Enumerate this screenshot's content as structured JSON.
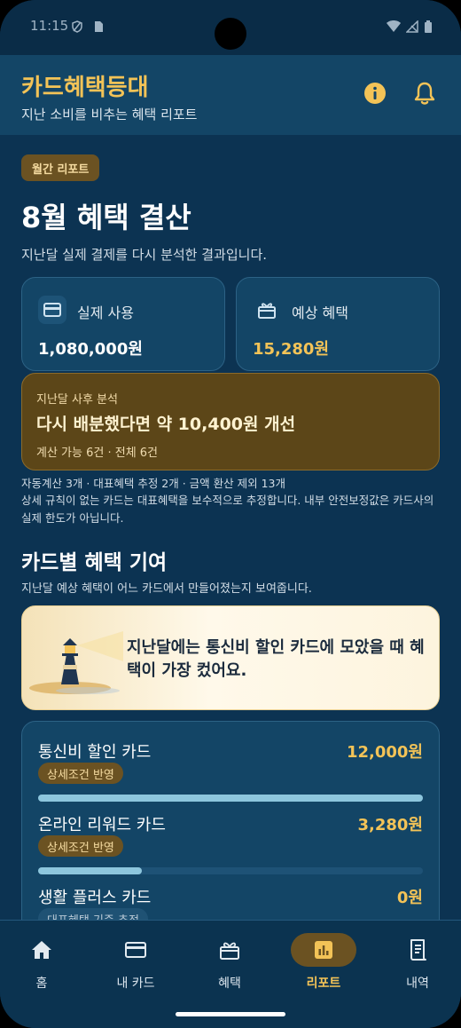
{
  "status_bar": {
    "time": "11:15"
  },
  "header": {
    "title": "카드혜택등대",
    "subtitle": "지난 소비를 비추는 혜택 리포트"
  },
  "report": {
    "badge": "월간 리포트",
    "title": "8월 혜택 결산",
    "description": "지난달 실제 결제를 다시 분석한 결과입니다."
  },
  "stats": [
    {
      "label": "실제 사용",
      "value": "1,080,000원",
      "icon": "credit-card-icon"
    },
    {
      "label": "예상 혜택",
      "value": "15,280원",
      "icon": "gift-icon"
    }
  ],
  "analysis": {
    "label": "지난달 사후 분석",
    "headline": "다시 배분했다면 약 10,400원 개선",
    "meta": "계산 가능 6건 · 전체 6건"
  },
  "notes": {
    "line1": "자동계산 3개 · 대표혜택 추정 2개 · 금액 환산 제외 13개",
    "line2": "상세 규칙이 없는 카드는 대표혜택을 보수적으로 추정합니다. 내부 안전보정값은 카드사의 실제 한도가 아닙니다."
  },
  "section": {
    "title": "카드별 혜택 기여",
    "description": "지난달 예상 혜택이 어느 카드에서 만들어졌는지 보여줍니다."
  },
  "insight": {
    "text": "지난달에는 통신비 할인 카드에 모았을 때 혜택이 가장 컸어요.",
    "icon": "lighthouse-illustration"
  },
  "cards": [
    {
      "name": "통신비 할인 카드",
      "value": "12,000원",
      "tag": "상세조건 반영",
      "share": 1.0
    },
    {
      "name": "온라인 리워드 카드",
      "value": "3,280원",
      "tag": "상세조건 반영",
      "share": 0.27
    },
    {
      "name": "생활 플러스 카드",
      "value": "0원",
      "tag": "대표혜택 기준 추정",
      "share": 0.0
    }
  ],
  "nav": [
    {
      "label": "홈",
      "icon": "home-icon",
      "active": false
    },
    {
      "label": "내 카드",
      "icon": "credit-card-icon",
      "active": false
    },
    {
      "label": "혜택",
      "icon": "gift-icon",
      "active": false
    },
    {
      "label": "리포트",
      "icon": "bar-chart-icon",
      "active": true
    },
    {
      "label": "내역",
      "icon": "receipt-icon",
      "active": false
    }
  ],
  "colors": {
    "background": "#0c3352",
    "header": "#134566",
    "accent": "#f3c357",
    "badge": "#6b5222",
    "analysis_card": "#5c4618",
    "bar_fill": "#8dc6dd"
  }
}
